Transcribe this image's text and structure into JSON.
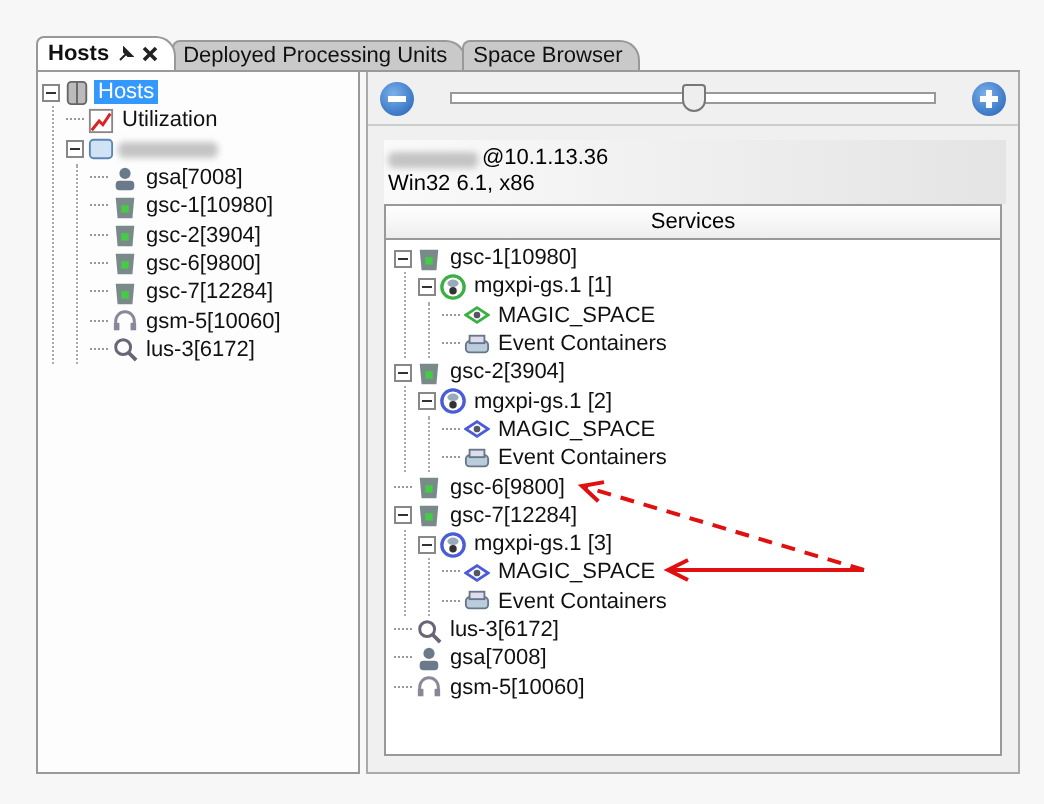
{
  "tabs": [
    {
      "label": "Hosts",
      "selected": true,
      "closable": true
    },
    {
      "label": "Deployed Processing Units",
      "selected": false,
      "closable": false
    },
    {
      "label": "Space Browser",
      "selected": false,
      "closable": false
    }
  ],
  "hosts_tree": [
    {
      "label": "Hosts",
      "kind": "group",
      "selected": true,
      "expanded": true,
      "children": [
        {
          "label": "Utilization",
          "kind": "utilization",
          "selected": false
        },
        {
          "kind": "machine",
          "redacted": true,
          "selected": false,
          "expanded": true,
          "children": [
            {
              "label": "gsa[7008]",
              "kind": "gsa",
              "selected": false
            },
            {
              "label": "gsc-1[10980]",
              "kind": "gsc",
              "selected": false
            },
            {
              "label": "gsc-2[3904]",
              "kind": "gsc",
              "selected": false
            },
            {
              "label": "gsc-6[9800]",
              "kind": "gsc",
              "selected": false
            },
            {
              "label": "gsc-7[12284]",
              "kind": "gsc",
              "selected": false
            },
            {
              "label": "gsm-5[10060]",
              "kind": "gsm",
              "selected": false
            },
            {
              "label": "lus-3[6172]",
              "kind": "lus",
              "selected": false
            }
          ]
        }
      ]
    }
  ],
  "zoom_slider": {
    "level": 0.5
  },
  "host_info": {
    "redacted_name": true,
    "address": "@10.1.13.36",
    "os": "Win32 6.1, x86"
  },
  "services": {
    "header": "Services",
    "tree": [
      {
        "label": "gsc-1[10980]",
        "kind": "gsc",
        "expanded": true,
        "children": [
          {
            "label": "mgxpi-gs.1 [1]",
            "kind": "pu",
            "color": "#3cb043",
            "expanded": true,
            "children": [
              {
                "label": "MAGIC_SPACE",
                "kind": "space",
                "color": "#3cb043"
              },
              {
                "label": "Event Containers",
                "kind": "event"
              }
            ]
          }
        ]
      },
      {
        "label": "gsc-2[3904]",
        "kind": "gsc",
        "expanded": true,
        "children": [
          {
            "label": "mgxpi-gs.1 [2]",
            "kind": "pu",
            "color": "#4a5cd6",
            "expanded": true,
            "children": [
              {
                "label": "MAGIC_SPACE",
                "kind": "space",
                "color": "#4a5cd6"
              },
              {
                "label": "Event Containers",
                "kind": "event"
              }
            ]
          }
        ]
      },
      {
        "label": "gsc-6[9800]",
        "kind": "gsc"
      },
      {
        "label": "gsc-7[12284]",
        "kind": "gsc",
        "expanded": true,
        "children": [
          {
            "label": "mgxpi-gs.1 [3]",
            "kind": "pu",
            "color": "#4a5cd6",
            "expanded": true,
            "children": [
              {
                "label": "MAGIC_SPACE",
                "kind": "space",
                "color": "#4a5cd6"
              },
              {
                "label": "Event Containers",
                "kind": "event"
              }
            ]
          }
        ]
      },
      {
        "label": "lus-3[6172]",
        "kind": "lus"
      },
      {
        "label": "gsa[7008]",
        "kind": "gsa"
      },
      {
        "label": "gsm-5[10060]",
        "kind": "gsm"
      }
    ]
  },
  "annotations": [
    {
      "kind": "arrow",
      "dashed": true
    },
    {
      "kind": "arrow",
      "dashed": false
    }
  ]
}
